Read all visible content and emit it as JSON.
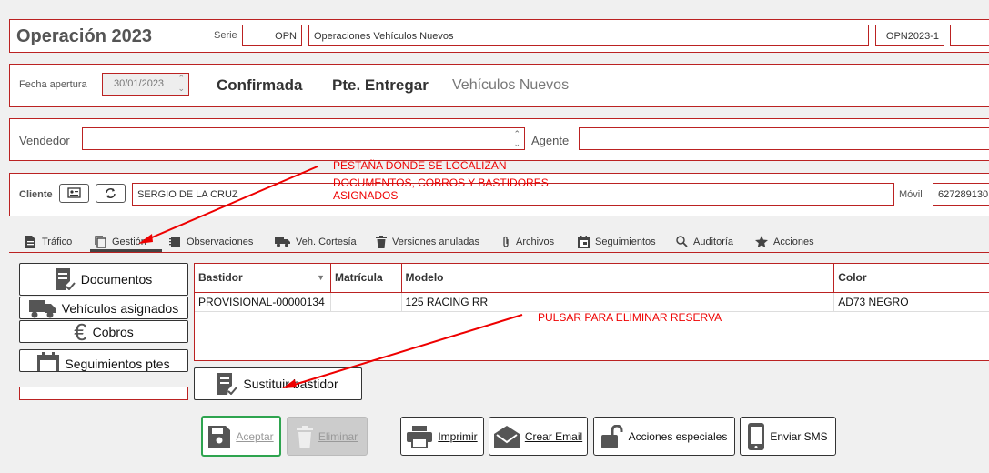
{
  "header": {
    "title": "Operación 2023",
    "serie_label": "Serie",
    "serie_code": "OPN",
    "serie_name": "Operaciones Vehículos Nuevos",
    "operation_code": "OPN2023-1",
    "extra_value": ""
  },
  "status_bar": {
    "fecha_label": "Fecha apertura",
    "fecha_value": "30/01/2023",
    "status1": "Confirmada",
    "status2": "Pte. Entregar",
    "status3": "Vehículos Nuevos"
  },
  "vendor": {
    "vendedor_label": "Vendedor",
    "vendedor_value": "",
    "agente_label": "Agente",
    "agente_value": ""
  },
  "client": {
    "cliente_label": "Cliente",
    "cliente_value": "SERGIO DE LA CRUZ",
    "movil_label": "Móvil",
    "movil_value": "627289130"
  },
  "tabs": [
    {
      "label": "Tráfico",
      "icon": "document-icon"
    },
    {
      "label": "Gestión",
      "icon": "copy-icon"
    },
    {
      "label": "Observaciones",
      "icon": "notebook-icon"
    },
    {
      "label": "Veh. Cortesía",
      "icon": "truck-icon"
    },
    {
      "label": "Versiones anuladas",
      "icon": "trash-icon"
    },
    {
      "label": "Archivos",
      "icon": "paperclip-icon"
    },
    {
      "label": "Seguimientos",
      "icon": "calendar-icon"
    },
    {
      "label": "Auditoría",
      "icon": "search-icon"
    },
    {
      "label": "Acciones",
      "icon": "star-icon"
    }
  ],
  "side_buttons": [
    {
      "label": "Documentos",
      "icon": "document-check-icon"
    },
    {
      "label": "Vehículos asignados",
      "icon": "truck-icon"
    },
    {
      "label": "Cobros",
      "icon": "euro-icon"
    },
    {
      "label": "Seguimientos ptes",
      "icon": "calendar-icon"
    }
  ],
  "table": {
    "columns": [
      "Bastidor",
      "Matrícula",
      "Modelo",
      "Color"
    ],
    "rows": [
      [
        "PROVISIONAL-00000134",
        "",
        "125 RACING RR",
        "AD73 NEGRO"
      ]
    ]
  },
  "sustituir_button": "Sustituir bastidor",
  "footer_buttons": {
    "aceptar": "Aceptar",
    "eliminar": "Eliminar",
    "imprimir": "Imprimir",
    "crear_email": "Crear Email",
    "acciones_especiales": "Acciones especiales",
    "enviar_sms": "Enviar SMS"
  },
  "annotations": {
    "note1": [
      "PESTAÑA DONDE SE LOCALIZAN",
      "DOCUMENTOS, COBROS Y BASTIDORES",
      "ASIGNADOS"
    ],
    "note2": "PULSAR PARA ELIMINAR RESERVA"
  },
  "colors": {
    "accent_red": "#b22222",
    "annotation_red": "#ee0000",
    "accept_green": "#2ea44f"
  }
}
